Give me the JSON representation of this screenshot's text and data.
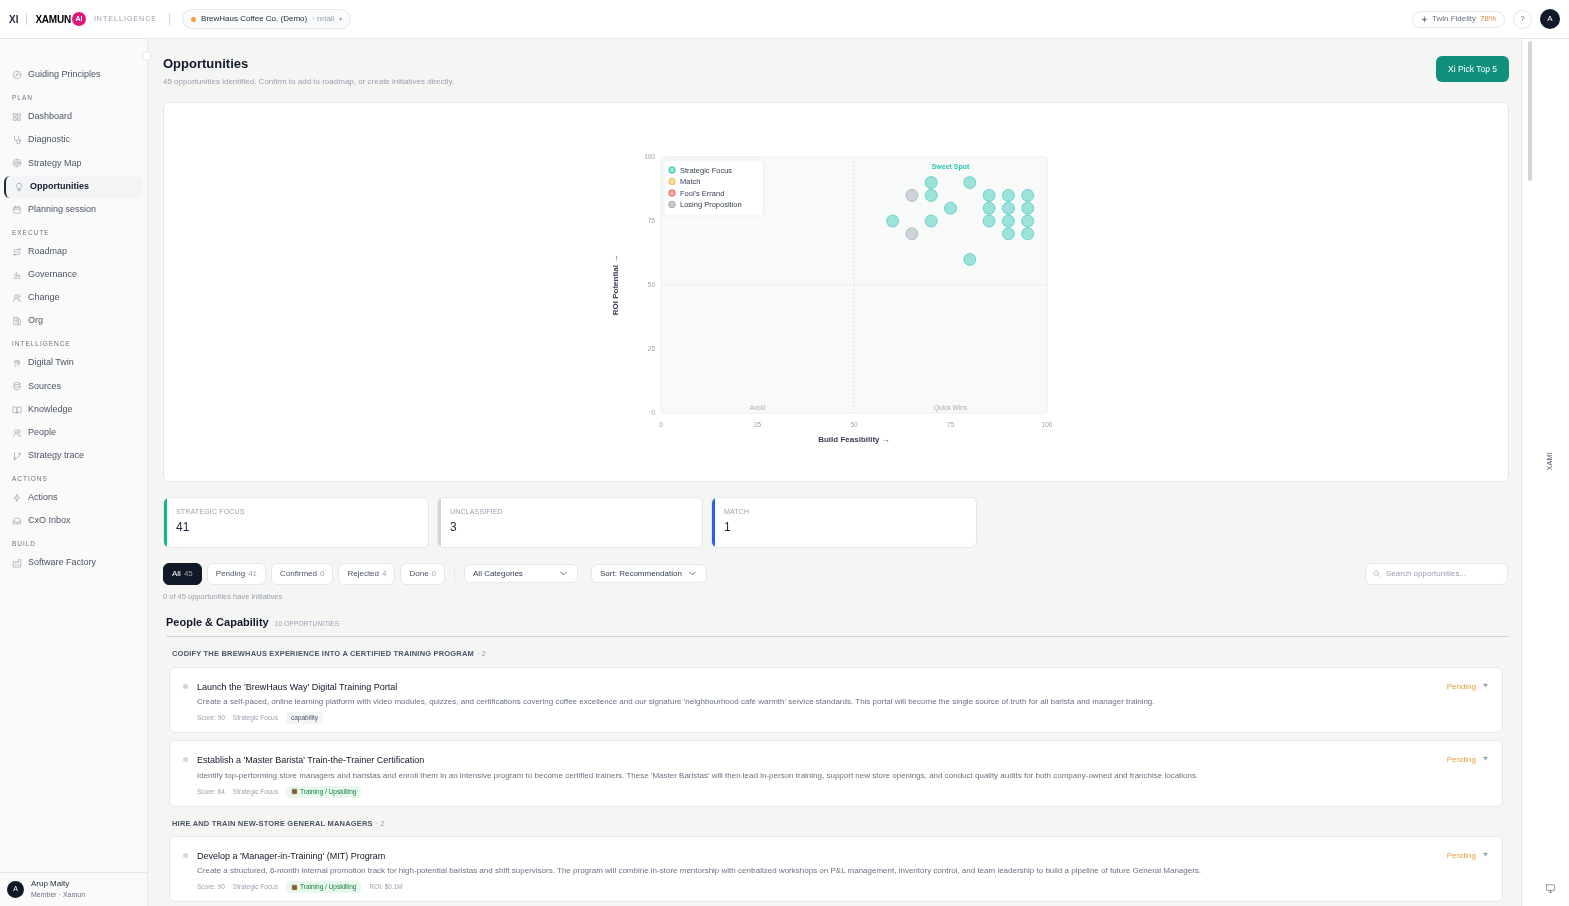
{
  "topbar": {
    "mark": "XI",
    "brand": "XAMUN",
    "brand_badge": "AI",
    "product": "INTELLIGENCE",
    "workspace": {
      "name": "BrewHaus Coffee Co. (Demo)",
      "segment": "· retail",
      "caret": "▾",
      "color": "#f59e42"
    },
    "fidelity": {
      "label": "Twin Fidelity",
      "value": "78%"
    },
    "help": "?",
    "avatar": "A"
  },
  "sidebar": {
    "sections": [
      {
        "items": [
          {
            "label": "Guiding Principles",
            "selected": false
          }
        ]
      },
      {
        "title": "PLAN",
        "items": [
          {
            "label": "Dashboard",
            "selected": false
          },
          {
            "label": "Diagnostic",
            "selected": false
          },
          {
            "label": "Strategy Map",
            "selected": false
          },
          {
            "label": "Opportunities",
            "selected": true
          },
          {
            "label": "Planning session",
            "selected": false
          }
        ]
      },
      {
        "title": "EXECUTE",
        "items": [
          {
            "label": "Roadmap",
            "selected": false
          },
          {
            "label": "Governance",
            "selected": false
          },
          {
            "label": "Change",
            "selected": false
          },
          {
            "label": "Org",
            "selected": false
          }
        ]
      },
      {
        "title": "INTELLIGENCE",
        "items": [
          {
            "label": "Digital Twin",
            "selected": false
          },
          {
            "label": "Sources",
            "selected": false
          },
          {
            "label": "Knowledge",
            "selected": false
          },
          {
            "label": "People",
            "selected": false
          },
          {
            "label": "Strategy trace",
            "selected": false
          }
        ]
      },
      {
        "title": "ACTIONS",
        "items": [
          {
            "label": "Actions",
            "selected": false
          },
          {
            "label": "CxO Inbox",
            "selected": false
          }
        ]
      },
      {
        "title": "BUILD",
        "items": [
          {
            "label": "Software Factory",
            "selected": false
          }
        ]
      }
    ],
    "user": {
      "avatar": "A",
      "name": "Arup Maity",
      "role": "Member · Xamun"
    }
  },
  "page": {
    "title": "Opportunities",
    "subtitle": "45 opportunities identified. Confirm to add to roadmap, or create initiatives directly.",
    "action": "Xi Pick Top 5"
  },
  "chart": {
    "quadrants": [
      {
        "label": "Sweet Spot",
        "kind": "top_right"
      },
      {
        "label": "Avoid",
        "kind": "bottom_left"
      },
      {
        "label": "Quick Wins",
        "kind": "bottom_right"
      }
    ],
    "chart_data": {
      "type": "scatter",
      "xlabel": "Build Feasibility →",
      "ylabel": "ROI Potential →",
      "xlim": [
        0,
        100
      ],
      "ylim": [
        0,
        100
      ],
      "xticks": [
        0,
        25,
        50,
        75,
        100
      ],
      "yticks": [
        0,
        25,
        50,
        75,
        100
      ],
      "legend": "upper left",
      "series": [
        {
          "name": "Strategic Focus",
          "color": "#2ec4b6",
          "x": [
            70,
            70,
            80,
            75,
            60,
            70,
            85,
            85,
            85,
            90,
            90,
            90,
            90,
            95,
            95,
            95,
            95,
            80
          ],
          "values": [
            90,
            85,
            90,
            80,
            75,
            75,
            85,
            80,
            75,
            85,
            80,
            75,
            70,
            85,
            80,
            75,
            70,
            60
          ]
        },
        {
          "name": "Match",
          "color": "#f6b84b"
        },
        {
          "name": "Fool's Errand",
          "color": "#ef5b5b"
        },
        {
          "name": "Losing Proposition",
          "color": "#9ca3af",
          "x": [
            65,
            65
          ],
          "values": [
            85,
            70
          ]
        }
      ]
    }
  },
  "summary": [
    {
      "label": "STRATEGIC FOCUS",
      "value": "41",
      "color": "#10b981"
    },
    {
      "label": "UNCLASSIFIED",
      "value": "3",
      "color": "#d1d5db"
    },
    {
      "label": "MATCH",
      "value": "1",
      "color": "#2563eb"
    }
  ],
  "filters": [
    {
      "label": "All",
      "count": "45",
      "selected": true
    },
    {
      "label": "Pending",
      "count": "41",
      "selected": false
    },
    {
      "label": "Confirmed",
      "count": "0",
      "selected": false
    },
    {
      "label": "Rejected",
      "count": "4",
      "selected": false
    },
    {
      "label": "Done",
      "count": "0",
      "selected": false
    }
  ],
  "category_select": "All Categories",
  "sort_select": "Sort: Recommendation",
  "search": {
    "placeholder": "Search opportunities..."
  },
  "initiatives_note": "0 of 45 opportunities have initiatives",
  "group": {
    "title": "People & Capability",
    "count": "10 OPPORTUNITIES",
    "themes": [
      {
        "title": "CODIFY THE BREWHAUS EXPERIENCE INTO A CERTIFIED TRAINING PROGRAM",
        "count": "· 2",
        "items": [
          {
            "title": "Launch the 'BrewHaus Way' Digital Training Portal",
            "description": "Create a self-paced, online learning platform with video modules, quizzes, and certifications covering coffee excellence and our signature 'neighbourhood café warmth' service standards. This portal will become the single source of truth for all barista and manager training.",
            "score": "Score: 90",
            "category": "Strategic Focus",
            "tag": {
              "label": "capability",
              "kind": "plain"
            },
            "status": "Pending"
          },
          {
            "title": "Establish a 'Master Barista' Train-the-Trainer Certification",
            "description": "Identify top-performing store managers and baristas and enroll them in an intensive program to become certified trainers. These 'Master Baristas' will then lead in-person training, support new store openings, and conduct quality audits for both company-owned and franchise locations.",
            "score": "Score: 84",
            "category": "Strategic Focus",
            "tag": {
              "label": "Training / Upskilling",
              "kind": "training"
            },
            "status": "Pending"
          }
        ]
      },
      {
        "title": "HIRE AND TRAIN NEW-STORE GENERAL MANAGERS",
        "count": "· 2",
        "items": [
          {
            "title": "Develop a 'Manager-in-Training' (MIT) Program",
            "description": "Create a structured, 6-month internal promotion track for high-potential baristas and shift supervisors. The program will combine in-store mentorship with centralized workshops on P&L management, inventory control, and team leadership to build a pipeline of future General Managers.",
            "score": "Score: 90",
            "category": "Strategic Focus",
            "tag": {
              "label": "Training / Upskilling",
              "kind": "training"
            },
            "roi": "ROI: $0.1M",
            "status": "Pending"
          }
        ]
      }
    ]
  },
  "side_panel": {
    "label": "XAMI"
  }
}
